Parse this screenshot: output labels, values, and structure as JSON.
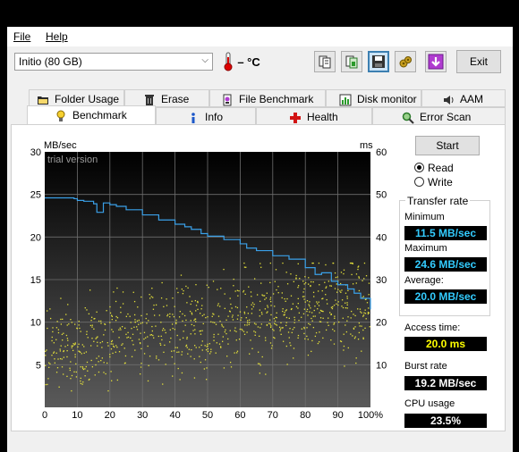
{
  "menu": {
    "file": "File",
    "help": "Help"
  },
  "toolbar": {
    "drive": "Initio (80 GB)",
    "temperature": "– °C",
    "exit_label": "Exit",
    "buttons": [
      "copy-info-icon",
      "copy-screenshot-icon",
      "save-icon",
      "options-icon",
      "download-icon"
    ]
  },
  "tabs_row1": [
    {
      "label": "Folder Usage",
      "icon": "folder-icon"
    },
    {
      "label": "Erase",
      "icon": "trash-icon"
    },
    {
      "label": "File Benchmark",
      "icon": "file-benchmark-icon"
    },
    {
      "label": "Disk monitor",
      "icon": "disk-monitor-icon"
    },
    {
      "label": "AAM",
      "icon": "speaker-icon"
    }
  ],
  "tabs_row2": [
    {
      "label": "Benchmark",
      "icon": "benchmark-icon",
      "active": true
    },
    {
      "label": "Info",
      "icon": "info-icon"
    },
    {
      "label": "Health",
      "icon": "health-icon"
    },
    {
      "label": "Error Scan",
      "icon": "magnifier-icon"
    }
  ],
  "chart_data": {
    "type": "line",
    "ylabel_left": "MB/sec",
    "ylabel_right": "ms",
    "watermark": "trial version",
    "x_ticks": [
      "0",
      "10",
      "20",
      "30",
      "40",
      "50",
      "60",
      "70",
      "80",
      "90",
      "100%"
    ],
    "y_left_ticks": [
      "30",
      "25",
      "20",
      "15",
      "10",
      "5"
    ],
    "y_right_ticks": [
      "60",
      "50",
      "40",
      "30",
      "20",
      "10"
    ],
    "xlim": [
      0,
      100
    ],
    "ylim_left": [
      0,
      30
    ],
    "ylim_right": [
      0,
      60
    ],
    "grid": true,
    "series": [
      {
        "name": "Transfer rate",
        "color": "#3aa0e8",
        "x": [
          0,
          5,
          9,
          10,
          12,
          15,
          16,
          18,
          20,
          22,
          25,
          30,
          35,
          40,
          43,
          45,
          48,
          50,
          55,
          60,
          62,
          65,
          70,
          75,
          80,
          83,
          85,
          88,
          90,
          93,
          95,
          97,
          100
        ],
        "y": [
          24.6,
          24.6,
          24.5,
          24.3,
          24.2,
          23.9,
          22.9,
          24.0,
          23.8,
          23.6,
          23.2,
          22.6,
          22.0,
          21.5,
          21.2,
          20.9,
          20.4,
          20.1,
          19.7,
          19.2,
          18.7,
          18.4,
          17.8,
          17.4,
          16.4,
          15.6,
          15.8,
          14.8,
          14.4,
          13.9,
          13.4,
          12.8,
          11.5
        ]
      }
    ],
    "access_time_scatter": {
      "name": "Access time",
      "color": "#e6e23a",
      "unit": "ms",
      "approx_range_ms": [
        4,
        30
      ]
    }
  },
  "controls": {
    "start_label": "Start",
    "read_label": "Read",
    "write_label": "Write",
    "read_selected": true
  },
  "stats": {
    "transfer_rate_title": "Transfer rate",
    "minimum_label": "Minimum",
    "minimum_value": "11.5 MB/sec",
    "maximum_label": "Maximum",
    "maximum_value": "24.6 MB/sec",
    "average_label": "Average:",
    "average_value": "20.0 MB/sec",
    "access_time_label": "Access time:",
    "access_time_value": "20.0 ms",
    "burst_rate_label": "Burst rate",
    "burst_rate_value": "19.2 MB/sec",
    "cpu_usage_label": "CPU usage",
    "cpu_usage_value": "23.5%"
  },
  "colors": {
    "rate_value_fg": "#33ccff",
    "access_value_fg": "#ffff00",
    "burst_value_fg": "#ffffff",
    "cpu_value_fg": "#ffffff",
    "plot_bg_top": "#000000",
    "plot_bg_bottom": "#5a5a5a",
    "grid": "#6e6e6e"
  }
}
